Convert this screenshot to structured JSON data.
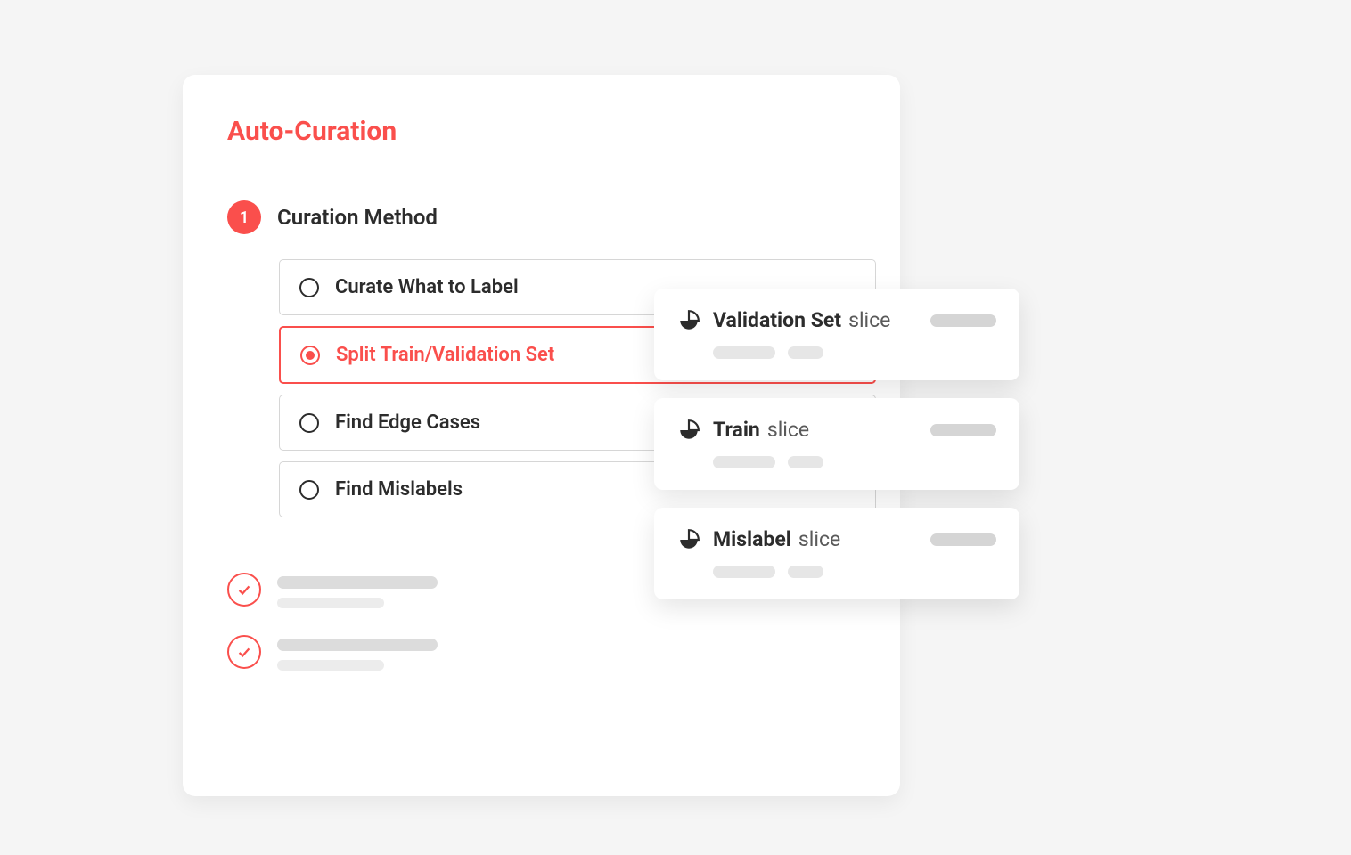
{
  "panel": {
    "title": "Auto-Curation",
    "step": {
      "number": "1",
      "title": "Curation Method",
      "options": [
        {
          "label": "Curate What to Label",
          "selected": false
        },
        {
          "label": "Split Train/Validation Set",
          "selected": true
        },
        {
          "label": "Find Edge Cases",
          "selected": false
        },
        {
          "label": "Find Mislabels",
          "selected": false
        }
      ]
    }
  },
  "cards": [
    {
      "title_bold": "Validation Set",
      "title_light": "slice"
    },
    {
      "title_bold": "Train",
      "title_light": "slice"
    },
    {
      "title_bold": "Mislabel",
      "title_light": "slice"
    }
  ],
  "colors": {
    "accent": "#fa4f4c",
    "text": "#2c2c2c"
  }
}
